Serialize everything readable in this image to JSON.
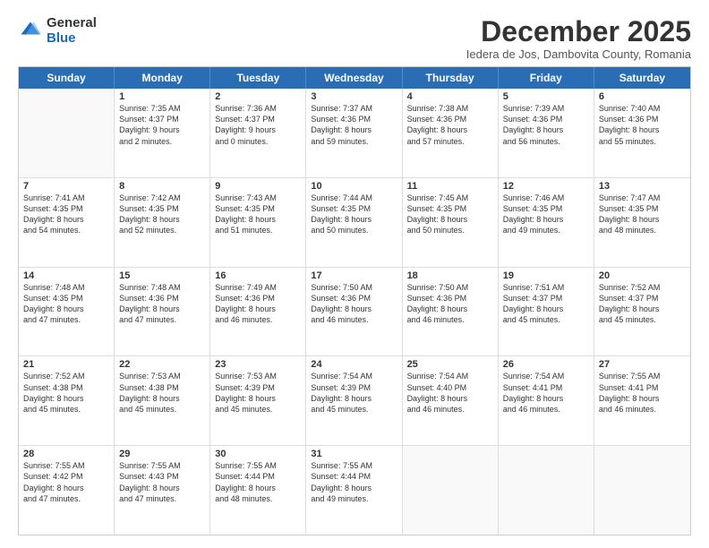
{
  "logo": {
    "general": "General",
    "blue": "Blue"
  },
  "title": "December 2025",
  "subtitle": "Iedera de Jos, Dambovita County, Romania",
  "days": [
    "Sunday",
    "Monday",
    "Tuesday",
    "Wednesday",
    "Thursday",
    "Friday",
    "Saturday"
  ],
  "weeks": [
    [
      {
        "day": "",
        "info": ""
      },
      {
        "day": "1",
        "info": "Sunrise: 7:35 AM\nSunset: 4:37 PM\nDaylight: 9 hours\nand 2 minutes."
      },
      {
        "day": "2",
        "info": "Sunrise: 7:36 AM\nSunset: 4:37 PM\nDaylight: 9 hours\nand 0 minutes."
      },
      {
        "day": "3",
        "info": "Sunrise: 7:37 AM\nSunset: 4:36 PM\nDaylight: 8 hours\nand 59 minutes."
      },
      {
        "day": "4",
        "info": "Sunrise: 7:38 AM\nSunset: 4:36 PM\nDaylight: 8 hours\nand 57 minutes."
      },
      {
        "day": "5",
        "info": "Sunrise: 7:39 AM\nSunset: 4:36 PM\nDaylight: 8 hours\nand 56 minutes."
      },
      {
        "day": "6",
        "info": "Sunrise: 7:40 AM\nSunset: 4:36 PM\nDaylight: 8 hours\nand 55 minutes."
      }
    ],
    [
      {
        "day": "7",
        "info": "Sunrise: 7:41 AM\nSunset: 4:35 PM\nDaylight: 8 hours\nand 54 minutes."
      },
      {
        "day": "8",
        "info": "Sunrise: 7:42 AM\nSunset: 4:35 PM\nDaylight: 8 hours\nand 52 minutes."
      },
      {
        "day": "9",
        "info": "Sunrise: 7:43 AM\nSunset: 4:35 PM\nDaylight: 8 hours\nand 51 minutes."
      },
      {
        "day": "10",
        "info": "Sunrise: 7:44 AM\nSunset: 4:35 PM\nDaylight: 8 hours\nand 50 minutes."
      },
      {
        "day": "11",
        "info": "Sunrise: 7:45 AM\nSunset: 4:35 PM\nDaylight: 8 hours\nand 50 minutes."
      },
      {
        "day": "12",
        "info": "Sunrise: 7:46 AM\nSunset: 4:35 PM\nDaylight: 8 hours\nand 49 minutes."
      },
      {
        "day": "13",
        "info": "Sunrise: 7:47 AM\nSunset: 4:35 PM\nDaylight: 8 hours\nand 48 minutes."
      }
    ],
    [
      {
        "day": "14",
        "info": "Sunrise: 7:48 AM\nSunset: 4:35 PM\nDaylight: 8 hours\nand 47 minutes."
      },
      {
        "day": "15",
        "info": "Sunrise: 7:48 AM\nSunset: 4:36 PM\nDaylight: 8 hours\nand 47 minutes."
      },
      {
        "day": "16",
        "info": "Sunrise: 7:49 AM\nSunset: 4:36 PM\nDaylight: 8 hours\nand 46 minutes."
      },
      {
        "day": "17",
        "info": "Sunrise: 7:50 AM\nSunset: 4:36 PM\nDaylight: 8 hours\nand 46 minutes."
      },
      {
        "day": "18",
        "info": "Sunrise: 7:50 AM\nSunset: 4:36 PM\nDaylight: 8 hours\nand 46 minutes."
      },
      {
        "day": "19",
        "info": "Sunrise: 7:51 AM\nSunset: 4:37 PM\nDaylight: 8 hours\nand 45 minutes."
      },
      {
        "day": "20",
        "info": "Sunrise: 7:52 AM\nSunset: 4:37 PM\nDaylight: 8 hours\nand 45 minutes."
      }
    ],
    [
      {
        "day": "21",
        "info": "Sunrise: 7:52 AM\nSunset: 4:38 PM\nDaylight: 8 hours\nand 45 minutes."
      },
      {
        "day": "22",
        "info": "Sunrise: 7:53 AM\nSunset: 4:38 PM\nDaylight: 8 hours\nand 45 minutes."
      },
      {
        "day": "23",
        "info": "Sunrise: 7:53 AM\nSunset: 4:39 PM\nDaylight: 8 hours\nand 45 minutes."
      },
      {
        "day": "24",
        "info": "Sunrise: 7:54 AM\nSunset: 4:39 PM\nDaylight: 8 hours\nand 45 minutes."
      },
      {
        "day": "25",
        "info": "Sunrise: 7:54 AM\nSunset: 4:40 PM\nDaylight: 8 hours\nand 46 minutes."
      },
      {
        "day": "26",
        "info": "Sunrise: 7:54 AM\nSunset: 4:41 PM\nDaylight: 8 hours\nand 46 minutes."
      },
      {
        "day": "27",
        "info": "Sunrise: 7:55 AM\nSunset: 4:41 PM\nDaylight: 8 hours\nand 46 minutes."
      }
    ],
    [
      {
        "day": "28",
        "info": "Sunrise: 7:55 AM\nSunset: 4:42 PM\nDaylight: 8 hours\nand 47 minutes."
      },
      {
        "day": "29",
        "info": "Sunrise: 7:55 AM\nSunset: 4:43 PM\nDaylight: 8 hours\nand 47 minutes."
      },
      {
        "day": "30",
        "info": "Sunrise: 7:55 AM\nSunset: 4:44 PM\nDaylight: 8 hours\nand 48 minutes."
      },
      {
        "day": "31",
        "info": "Sunrise: 7:55 AM\nSunset: 4:44 PM\nDaylight: 8 hours\nand 49 minutes."
      },
      {
        "day": "",
        "info": ""
      },
      {
        "day": "",
        "info": ""
      },
      {
        "day": "",
        "info": ""
      }
    ]
  ]
}
